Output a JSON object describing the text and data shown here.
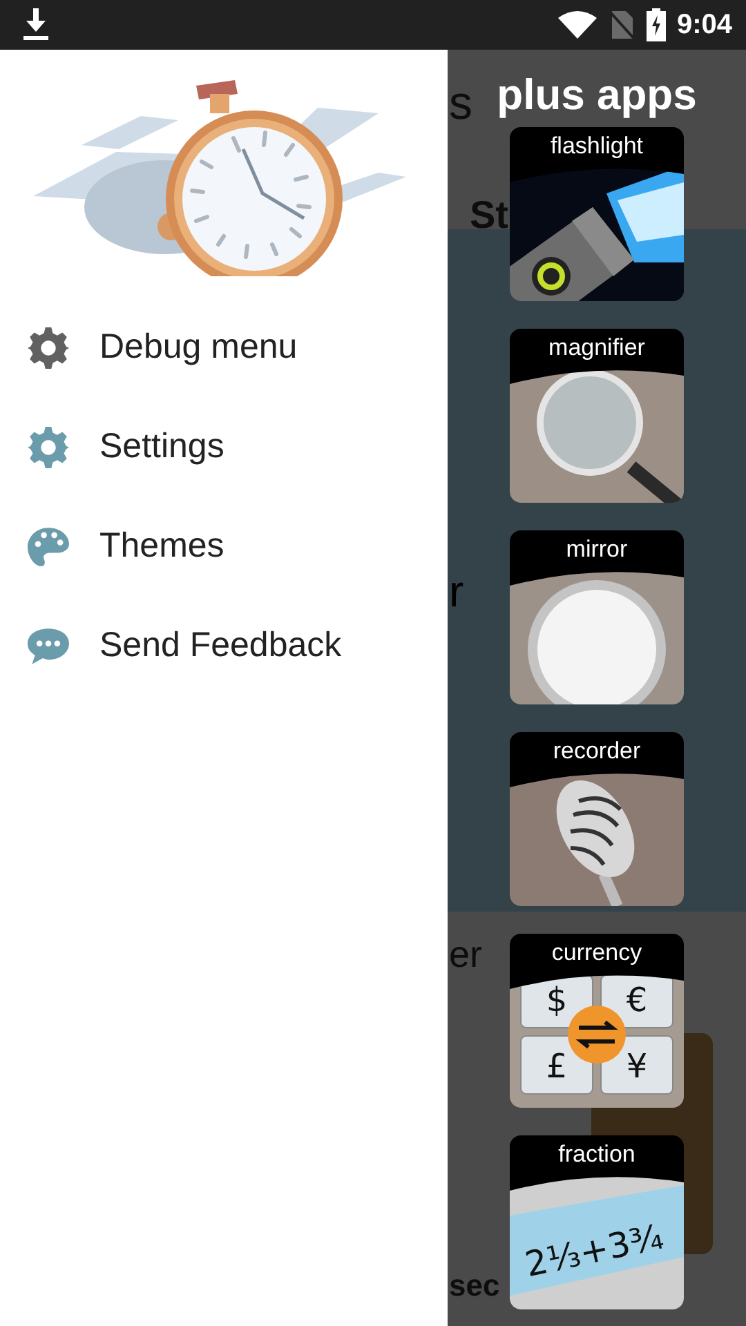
{
  "status_bar": {
    "time": "9:04"
  },
  "drawer": {
    "items": [
      {
        "label": "Debug menu",
        "kind": "gear",
        "color": "#616161"
      },
      {
        "label": "Settings",
        "kind": "gear",
        "color": "#6b9cab"
      },
      {
        "label": "Themes",
        "kind": "palette",
        "color": "#6b9cab"
      },
      {
        "label": "Send Feedback",
        "kind": "chat",
        "color": "#6b9cab"
      }
    ]
  },
  "covered_app": {
    "fragments": [
      {
        "text": "s"
      },
      {
        "text": "St"
      },
      {
        "text": "r"
      },
      {
        "text": "er"
      },
      {
        "text": "sec"
      }
    ]
  },
  "plus_apps": {
    "title": "plus apps",
    "apps": [
      {
        "label": "flashlight",
        "kind": "flashlight"
      },
      {
        "label": "magnifier",
        "kind": "magnifier"
      },
      {
        "label": "mirror",
        "kind": "mirror"
      },
      {
        "label": "recorder",
        "kind": "recorder"
      },
      {
        "label": "currency",
        "kind": "currency",
        "symbols": [
          "$",
          "€",
          "£",
          "¥"
        ]
      },
      {
        "label": "fraction",
        "kind": "fraction",
        "expression": "2⅓+3¾"
      }
    ]
  }
}
